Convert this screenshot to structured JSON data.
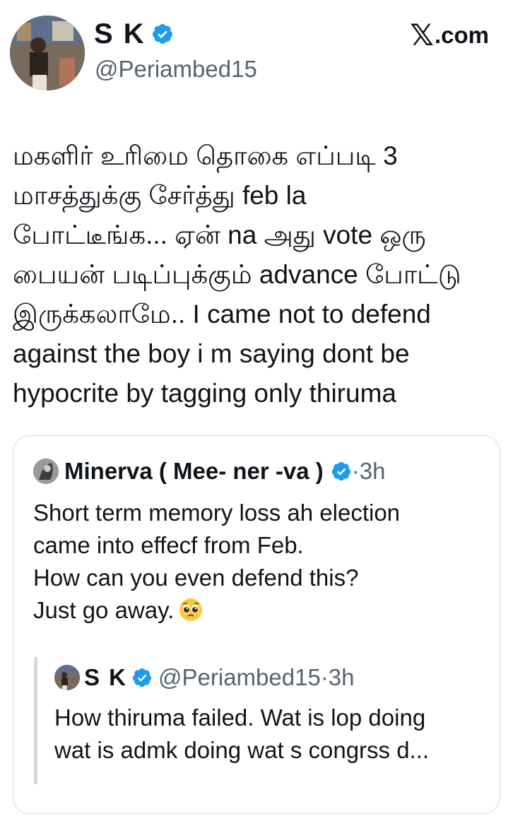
{
  "site": "com",
  "post": {
    "author_name": "S K",
    "handle": "@Periambed15",
    "text": "மகளிர் உரிமை தொகை எப்படி 3\nமாசத்துக்கு சேர்த்து feb la\nபோட்டீங்க... ஏன் na அது vote ஒரு\nபையன் படிப்புக்கும் advance போட்டு\nஇருக்கலாமே.. I came not to defend\nagainst the boy i m saying dont be\nhypocrite by tagging only thiruma"
  },
  "quoted": {
    "author_name": "Minerva ( Mee- ner -va )",
    "time": "·3h",
    "text": "Short term memory loss ah election\ncame into effecf from Feb.\nHow can you even defend this?\nJust go away.",
    "emoji": "pleading-face-emoji",
    "nested": {
      "author_name": "S K",
      "handle": "@Periambed15",
      "time": "·3h",
      "text": "How thiruma failed. Wat is lop doing\nwat is admk doing wat s congrss d..."
    }
  },
  "colors": {
    "verified": "#1d9bf0",
    "secondary_text": "#536471",
    "border": "#d8dee3"
  }
}
